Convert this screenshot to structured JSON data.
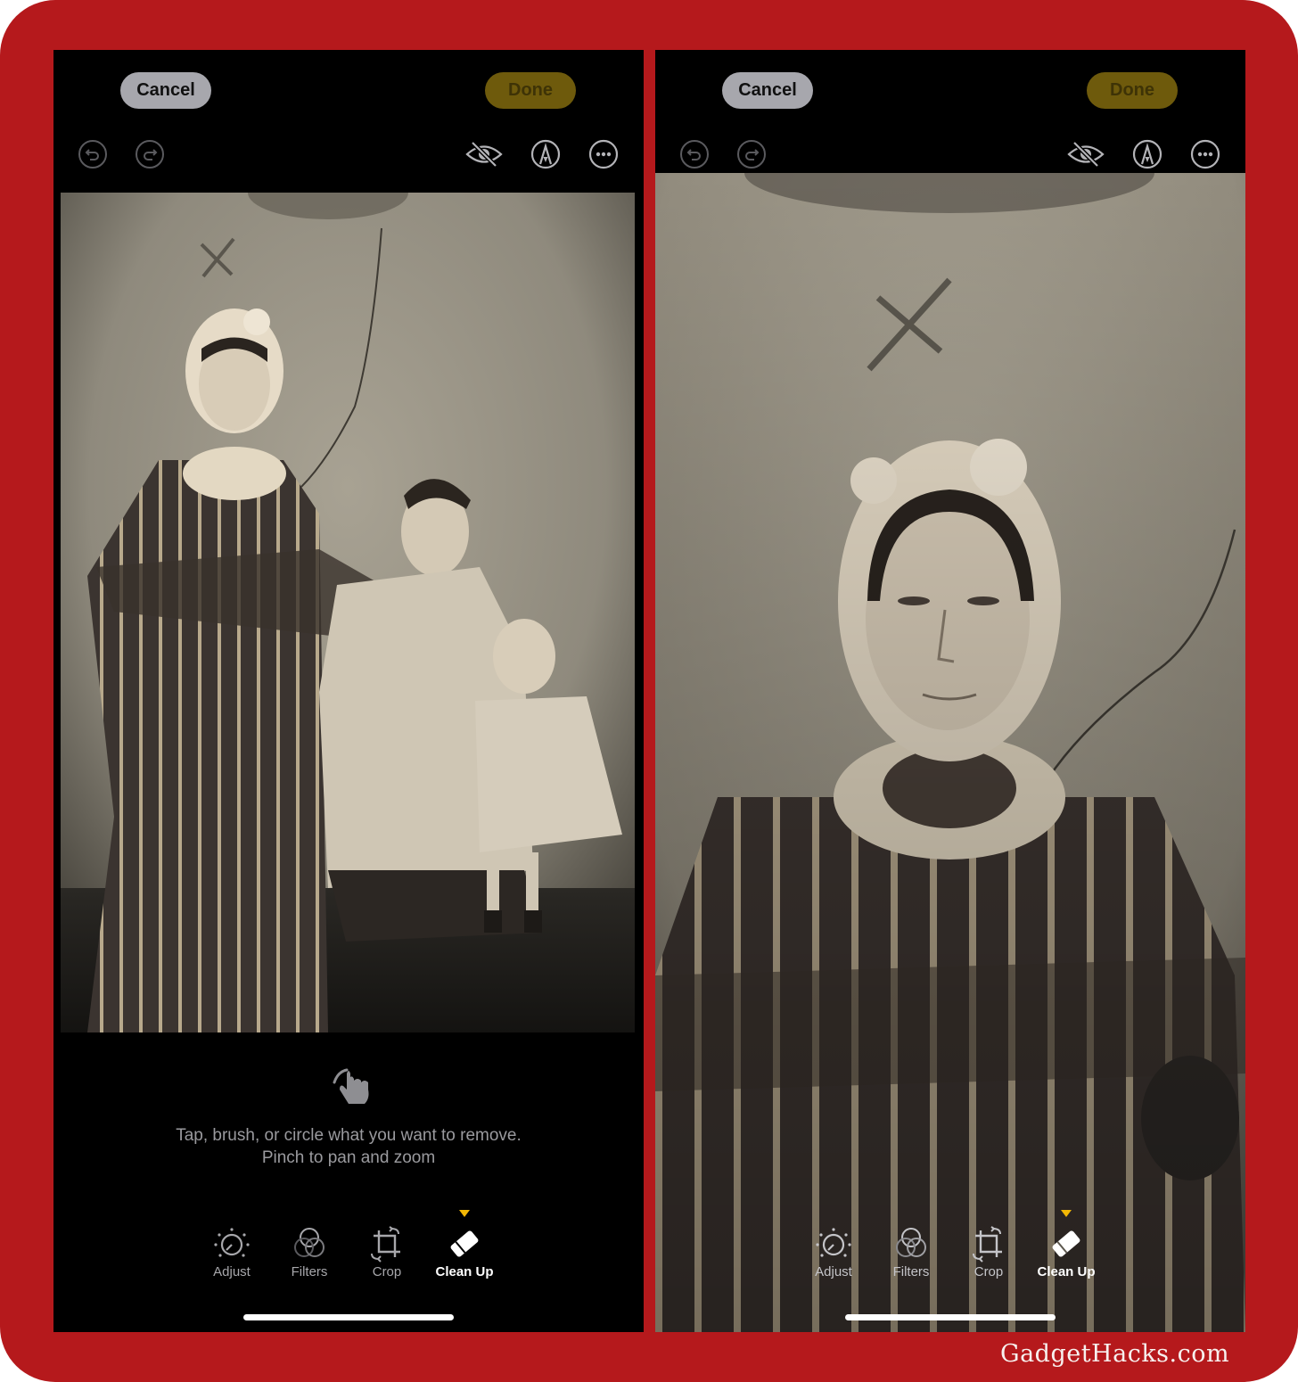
{
  "panels": [
    {
      "id": "left",
      "header": {
        "cancel_label": "Cancel",
        "done_label": "Done"
      },
      "top_tools": [
        "undo-icon",
        "redo-icon",
        "hide-eye-icon",
        "markup-pen-icon",
        "more-icon"
      ],
      "photo": {
        "description": "Antique tintype portrait of a family: standing woman in striped dress with lace bonnet, seated man, toddler on lap",
        "view": "full"
      },
      "hint": {
        "icon": "hand-tap-icon",
        "line1": "Tap, brush, or circle what you want to remove.",
        "line2": "Pinch to pan and zoom"
      },
      "toolbar": {
        "items": [
          {
            "label": "Adjust",
            "icon": "adjust-dial-icon",
            "active": false
          },
          {
            "label": "Filters",
            "icon": "filters-circles-icon",
            "active": false
          },
          {
            "label": "Crop",
            "icon": "crop-rotate-icon",
            "active": false
          },
          {
            "label": "Clean Up",
            "icon": "eraser-icon",
            "active": true
          }
        ]
      }
    },
    {
      "id": "right",
      "header": {
        "cancel_label": "Cancel",
        "done_label": "Done"
      },
      "top_tools": [
        "undo-icon",
        "redo-icon",
        "hide-eye-icon",
        "markup-pen-icon",
        "more-icon"
      ],
      "photo": {
        "description": "Zoomed-in view of the woman in lace bonnet and striped dress from the tintype",
        "view": "zoomed"
      },
      "toolbar": {
        "items": [
          {
            "label": "Adjust",
            "icon": "adjust-dial-icon",
            "active": false
          },
          {
            "label": "Filters",
            "icon": "filters-circles-icon",
            "active": false
          },
          {
            "label": "Crop",
            "icon": "crop-rotate-icon",
            "active": false
          },
          {
            "label": "Clean Up",
            "icon": "eraser-icon",
            "active": true
          }
        ]
      }
    }
  ],
  "colors": {
    "frame": "#b5191c",
    "done_button": "#6e5a0c",
    "cancel_button": "#a7a7ad",
    "active_indicator": "#f2b705"
  },
  "watermark": "GadgetHacks.com"
}
